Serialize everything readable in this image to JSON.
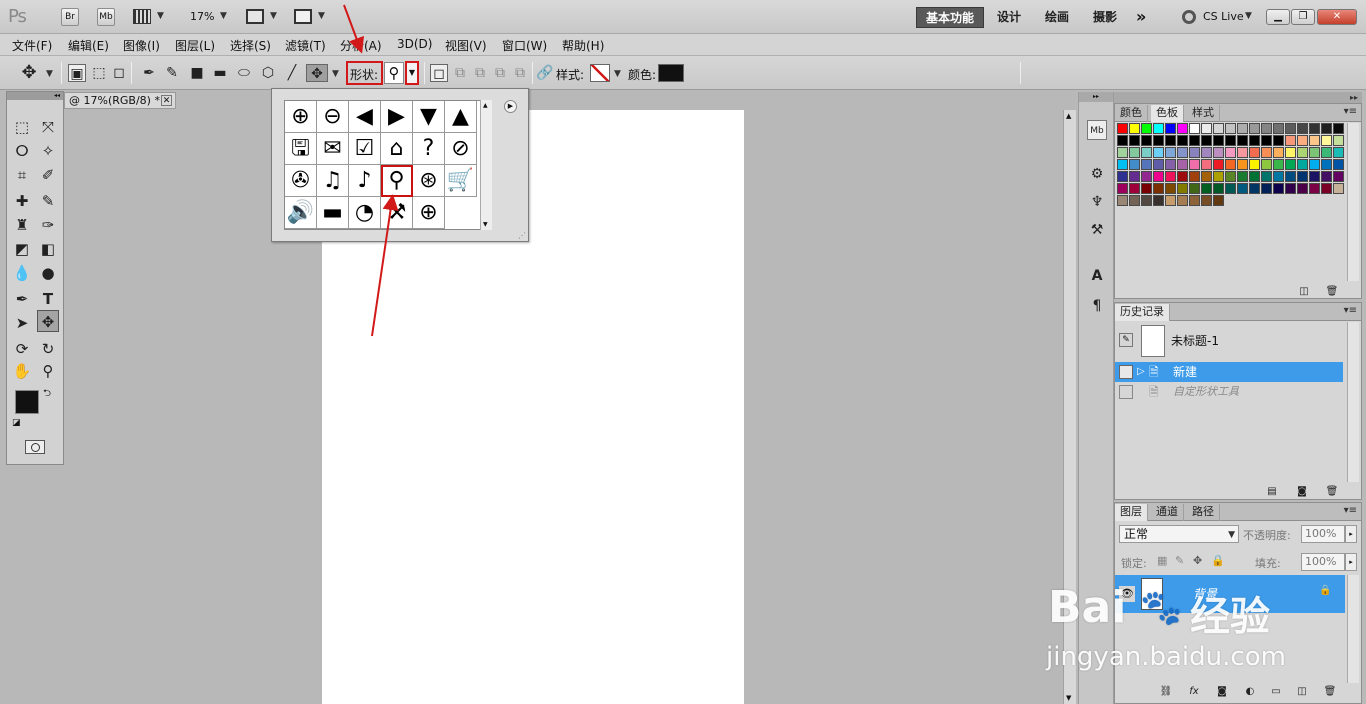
{
  "app": {
    "logo": "Ps",
    "bridge_label": "Br",
    "minibridge_label": "Mb",
    "zoom": "17%",
    "workspaces": [
      "基本功能",
      "设计",
      "绘画",
      "摄影"
    ],
    "more_label": "»",
    "cslive_label": "CS Live"
  },
  "menu": [
    "文件(F)",
    "编辑(E)",
    "图像(I)",
    "图层(L)",
    "选择(S)",
    "滤镜(T)",
    "分析(A)",
    "3D(D)",
    "视图(V)",
    "窗口(W)",
    "帮助(H)"
  ],
  "options": {
    "shape_label": "形状:",
    "style_label": "样式:",
    "color_label": "颜色:",
    "color_value": "#111111"
  },
  "document": {
    "tab_label": "@ 17%(RGB/8) *",
    "close": "✕"
  },
  "shape_popup": {
    "menu_btn": "▶",
    "shapes": [
      {
        "name": "plus-shape",
        "glyph": "⊕"
      },
      {
        "name": "minus-shape",
        "glyph": "⊖"
      },
      {
        "name": "left-arrow-shape",
        "glyph": "◀"
      },
      {
        "name": "right-arrow-shape",
        "glyph": "▶"
      },
      {
        "name": "down-arrow-shape",
        "glyph": "▼"
      },
      {
        "name": "up-arrow-shape",
        "glyph": "▲"
      },
      {
        "name": "save-shape",
        "glyph": "🖫"
      },
      {
        "name": "envelope-shape",
        "glyph": "✉"
      },
      {
        "name": "checkmark-shape",
        "glyph": "☑"
      },
      {
        "name": "house-shape",
        "glyph": "⌂"
      },
      {
        "name": "question-shape",
        "glyph": "?"
      },
      {
        "name": "no-sign-shape",
        "glyph": "⊘"
      },
      {
        "name": "film-reel-shape",
        "glyph": "✇"
      },
      {
        "name": "note-shape",
        "glyph": "♫"
      },
      {
        "name": "note-circle-shape",
        "glyph": "♪"
      },
      {
        "name": "magnifier-shape",
        "glyph": "⚲"
      },
      {
        "name": "web-search-shape",
        "glyph": "⊛"
      },
      {
        "name": "cart-shape",
        "glyph": "🛒"
      },
      {
        "name": "speaker-shape",
        "glyph": "🔊"
      },
      {
        "name": "bar-shape",
        "glyph": "▬"
      },
      {
        "name": "clock-shape",
        "glyph": "◔"
      },
      {
        "name": "tools-shape",
        "glyph": "⚒"
      },
      {
        "name": "globe-shape",
        "glyph": "⊕"
      }
    ]
  },
  "panels": {
    "swatch_tabs": [
      "颜色",
      "色板",
      "样式"
    ],
    "history_tab": "历史记录",
    "history_snapshot": "未标题-1",
    "history_items": [
      "新建",
      "自定形状工具"
    ],
    "layer_tabs": [
      "图层",
      "通道",
      "路径"
    ],
    "blend_mode": "正常",
    "opacity_label": "不透明度:",
    "opacity_value": "100%",
    "lock_label": "锁定:",
    "fill_label": "填充:",
    "fill_value": "100%",
    "layer_name": "背景"
  },
  "watermark": {
    "brand_left": "Bai",
    "brand_right": "经验",
    "url": "jingyan.baidu.com"
  },
  "colors": {
    "accent_blue": "#3d9be9",
    "annotation_red": "#d21919"
  }
}
